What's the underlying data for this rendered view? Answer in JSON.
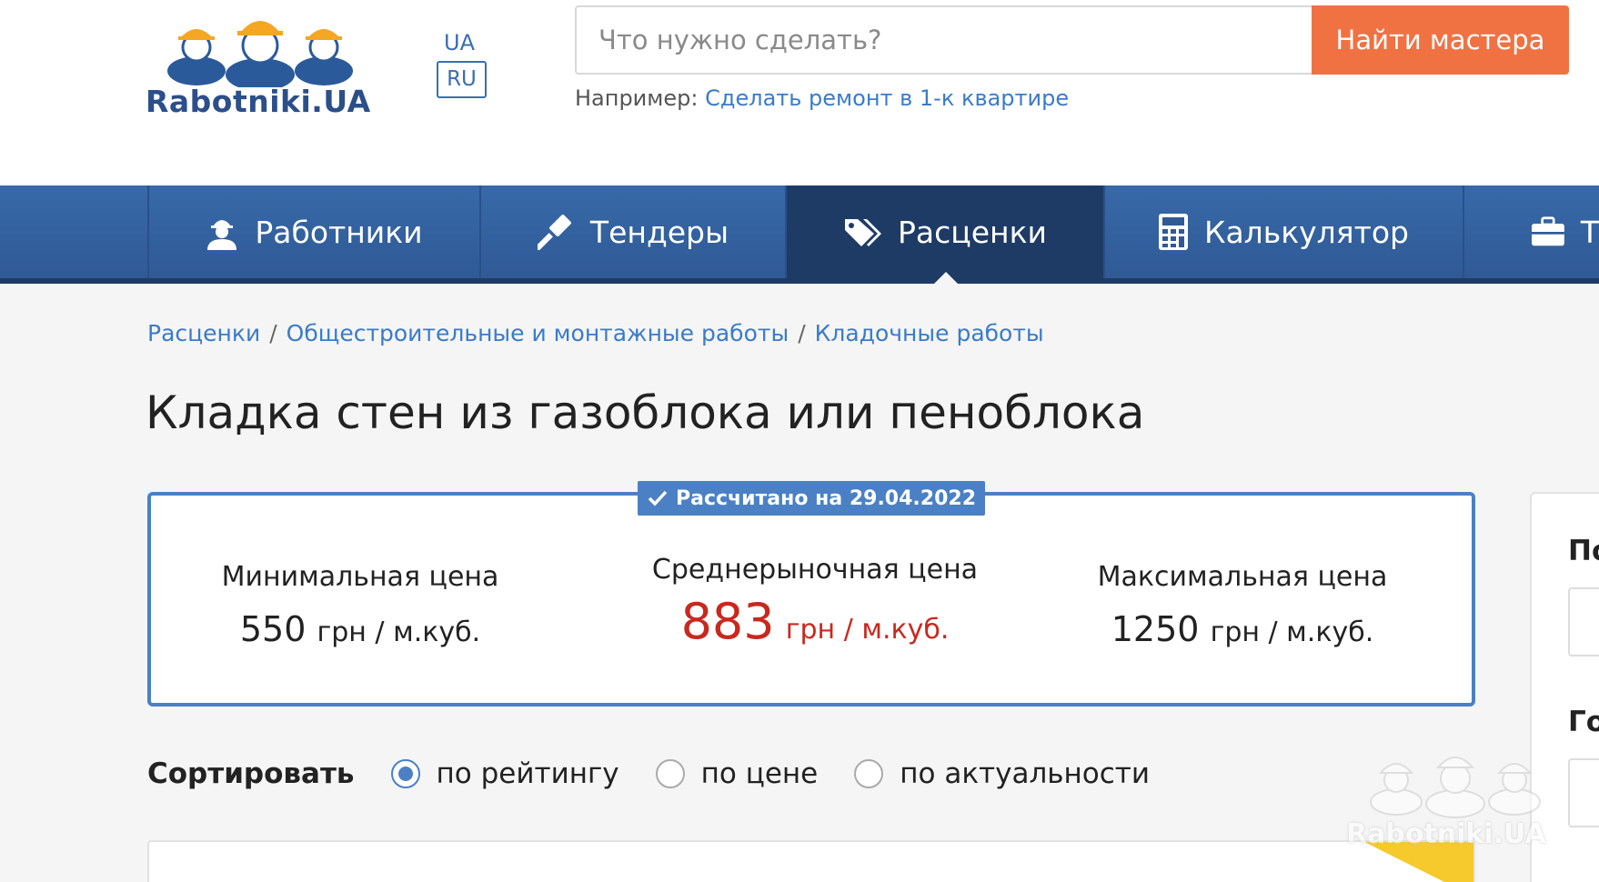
{
  "header": {
    "logo_text": "Rabotniki.UA",
    "lang_ua": "UA",
    "lang_ru": "RU",
    "search_placeholder": "Что нужно сделать?",
    "search_button": "Найти мастера",
    "example_prefix": "Например:",
    "example_link": "Сделать ремонт в 1-к квартире"
  },
  "nav": {
    "items": [
      {
        "label": "Работники",
        "icon": "worker-icon"
      },
      {
        "label": "Тендеры",
        "icon": "gavel-icon"
      },
      {
        "label": "Расценки",
        "icon": "tags-icon",
        "active": true
      },
      {
        "label": "Калькулятор",
        "icon": "calculator-icon"
      },
      {
        "label": "Т",
        "icon": "briefcase-icon"
      }
    ]
  },
  "breadcrumb": [
    "Расценки",
    "Общестроительные и монтажные работы",
    "Кладочные работы"
  ],
  "page_title": "Кладка стен из газоблока или пеноблока",
  "prices": {
    "badge": "Рассчитано на 29.04.2022",
    "min_label": "Минимальная цена",
    "min_value": "550",
    "min_unit": "грн / м.куб.",
    "avg_label": "Среднерыночная цена",
    "avg_value": "883",
    "avg_unit": "грн / м.куб.",
    "max_label": "Максимальная цена",
    "max_value": "1250",
    "max_unit": "грн / м.куб."
  },
  "sort": {
    "label": "Сортировать",
    "options": [
      "по рейтингу",
      "по цене",
      "по актуальности"
    ],
    "selected": "по рейтингу"
  },
  "sidebar": {
    "heading1": "По",
    "heading2": "Го"
  },
  "watermark": "Rabotniki.UA",
  "colors": {
    "accent": "#f07243",
    "nav": "#2f5a96",
    "nav_active": "#1e3b66",
    "link": "#3a7bc8",
    "avg_price": "#c8291e",
    "box_border": "#4b80c4"
  }
}
